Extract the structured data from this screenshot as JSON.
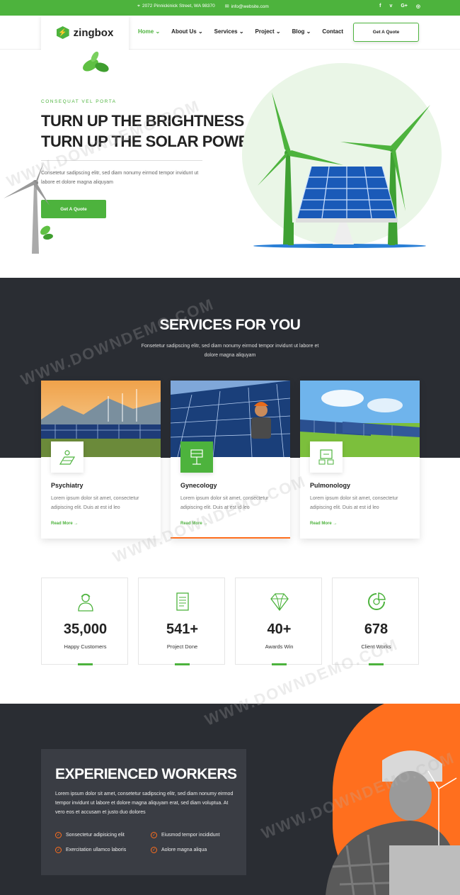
{
  "topbar": {
    "address": "2072 Pinnickinick Street, WA 98370",
    "email": "info@website.com",
    "social": [
      "f",
      "v",
      "G+",
      "◎"
    ]
  },
  "header": {
    "logo": "zingbox",
    "nav": [
      "Home",
      "About Us",
      "Services",
      "Project",
      "Blog",
      "Contact"
    ],
    "quote_button": "Get A Quote"
  },
  "hero": {
    "kicker": "CONSEQUAT VEL PORTA",
    "title_line1": "TURN UP THE BRIGHTNESS",
    "title_line2": "TURN UP THE SOLAR POWER.",
    "description": "Consetetur sadipscing elitr, sed diam nonumy eirmod tempor invidunt ut labore et dolore magna aliquyam",
    "cta": "Get A Quote"
  },
  "services": {
    "title": "SERVICES FOR YOU",
    "subtitle": "Fonsetetur sadipscing elitr, sed diam nonumy eirmod tempor invidunt ut labore et dolore magna aliquyam",
    "cards": [
      {
        "title": "Psychiatry",
        "text": "Lorem ipsum dolor sit amet, consectetur adipiscing elit. Duis at est id leo",
        "more": "Read More →"
      },
      {
        "title": "Gynecology",
        "text": "Lorem ipsum dolor sit amet, consectetur adipiscing elit. Duis at est id leo",
        "more": "Read More →"
      },
      {
        "title": "Pulmonology",
        "text": "Lorem ipsum dolor sit amet, consectetur adipiscing elit. Duis at est id leo",
        "more": "Read More →"
      }
    ]
  },
  "stats": [
    {
      "number": "35,000",
      "label": "Happy Customers"
    },
    {
      "number": "541+",
      "label": "Project Done"
    },
    {
      "number": "40+",
      "label": "Awards Win"
    },
    {
      "number": "678",
      "label": "Client Works"
    }
  ],
  "workers": {
    "title": "EXPERIENCED WORKERS",
    "paragraph": "Lorem ipsum dolor sit amet, consetetur sadipscing elitr, sed diam nonumy eirmod tempor invidunt ut labore et dolore magna aliquyam erat, sed diam voluptua. At vero eos et accusam et justo duo dolores",
    "checks": [
      "Sonsectetur adipisicing elit",
      "Eiusmod tempor incididunt",
      "Exercitation ullamco laboris",
      "Aolore magna aliqua"
    ]
  },
  "watermark": "WWW.DOWNDEMO.COM",
  "colors": {
    "green": "#4db33d",
    "orange": "#ff6f1e",
    "dark": "#2a2d33"
  }
}
